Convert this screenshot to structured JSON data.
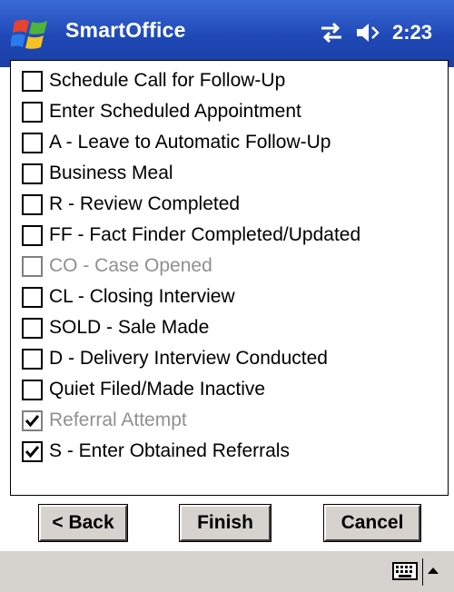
{
  "titlebar": {
    "app_title": "SmartOffice",
    "clock": "2:23",
    "start_icon": "windows-flag-icon",
    "connectivity_icon": "connectivity-arrows-icon",
    "volume_icon": "speaker-icon"
  },
  "items": [
    {
      "label": "Schedule Call for Follow-Up",
      "checked": false,
      "disabled": false
    },
    {
      "label": "Enter Scheduled Appointment",
      "checked": false,
      "disabled": false
    },
    {
      "label": "A - Leave to Automatic Follow-Up",
      "checked": false,
      "disabled": false
    },
    {
      "label": "Business Meal",
      "checked": false,
      "disabled": false
    },
    {
      "label": "R - Review Completed",
      "checked": false,
      "disabled": false
    },
    {
      "label": "FF - Fact Finder Completed/Updated",
      "checked": false,
      "disabled": false
    },
    {
      "label": "CO - Case Opened",
      "checked": false,
      "disabled": true
    },
    {
      "label": "CL - Closing Interview",
      "checked": false,
      "disabled": false
    },
    {
      "label": "SOLD - Sale Made",
      "checked": false,
      "disabled": false
    },
    {
      "label": "D - Delivery Interview Conducted",
      "checked": false,
      "disabled": false
    },
    {
      "label": "Quiet Filed/Made Inactive",
      "checked": false,
      "disabled": false
    },
    {
      "label": "Referral Attempt",
      "checked": true,
      "disabled": true
    },
    {
      "label": "S - Enter Obtained Referrals",
      "checked": true,
      "disabled": false
    }
  ],
  "buttons": {
    "back": "< Back",
    "finish": "Finish",
    "cancel": "Cancel"
  },
  "bottom_bar": {
    "keyboard_icon": "keyboard-icon",
    "sip_arrow_icon": "up-arrow-icon"
  },
  "colors": {
    "titlebar": "#1f48b6",
    "disabled_text": "#909090",
    "button_face": "#d6d3ce"
  }
}
